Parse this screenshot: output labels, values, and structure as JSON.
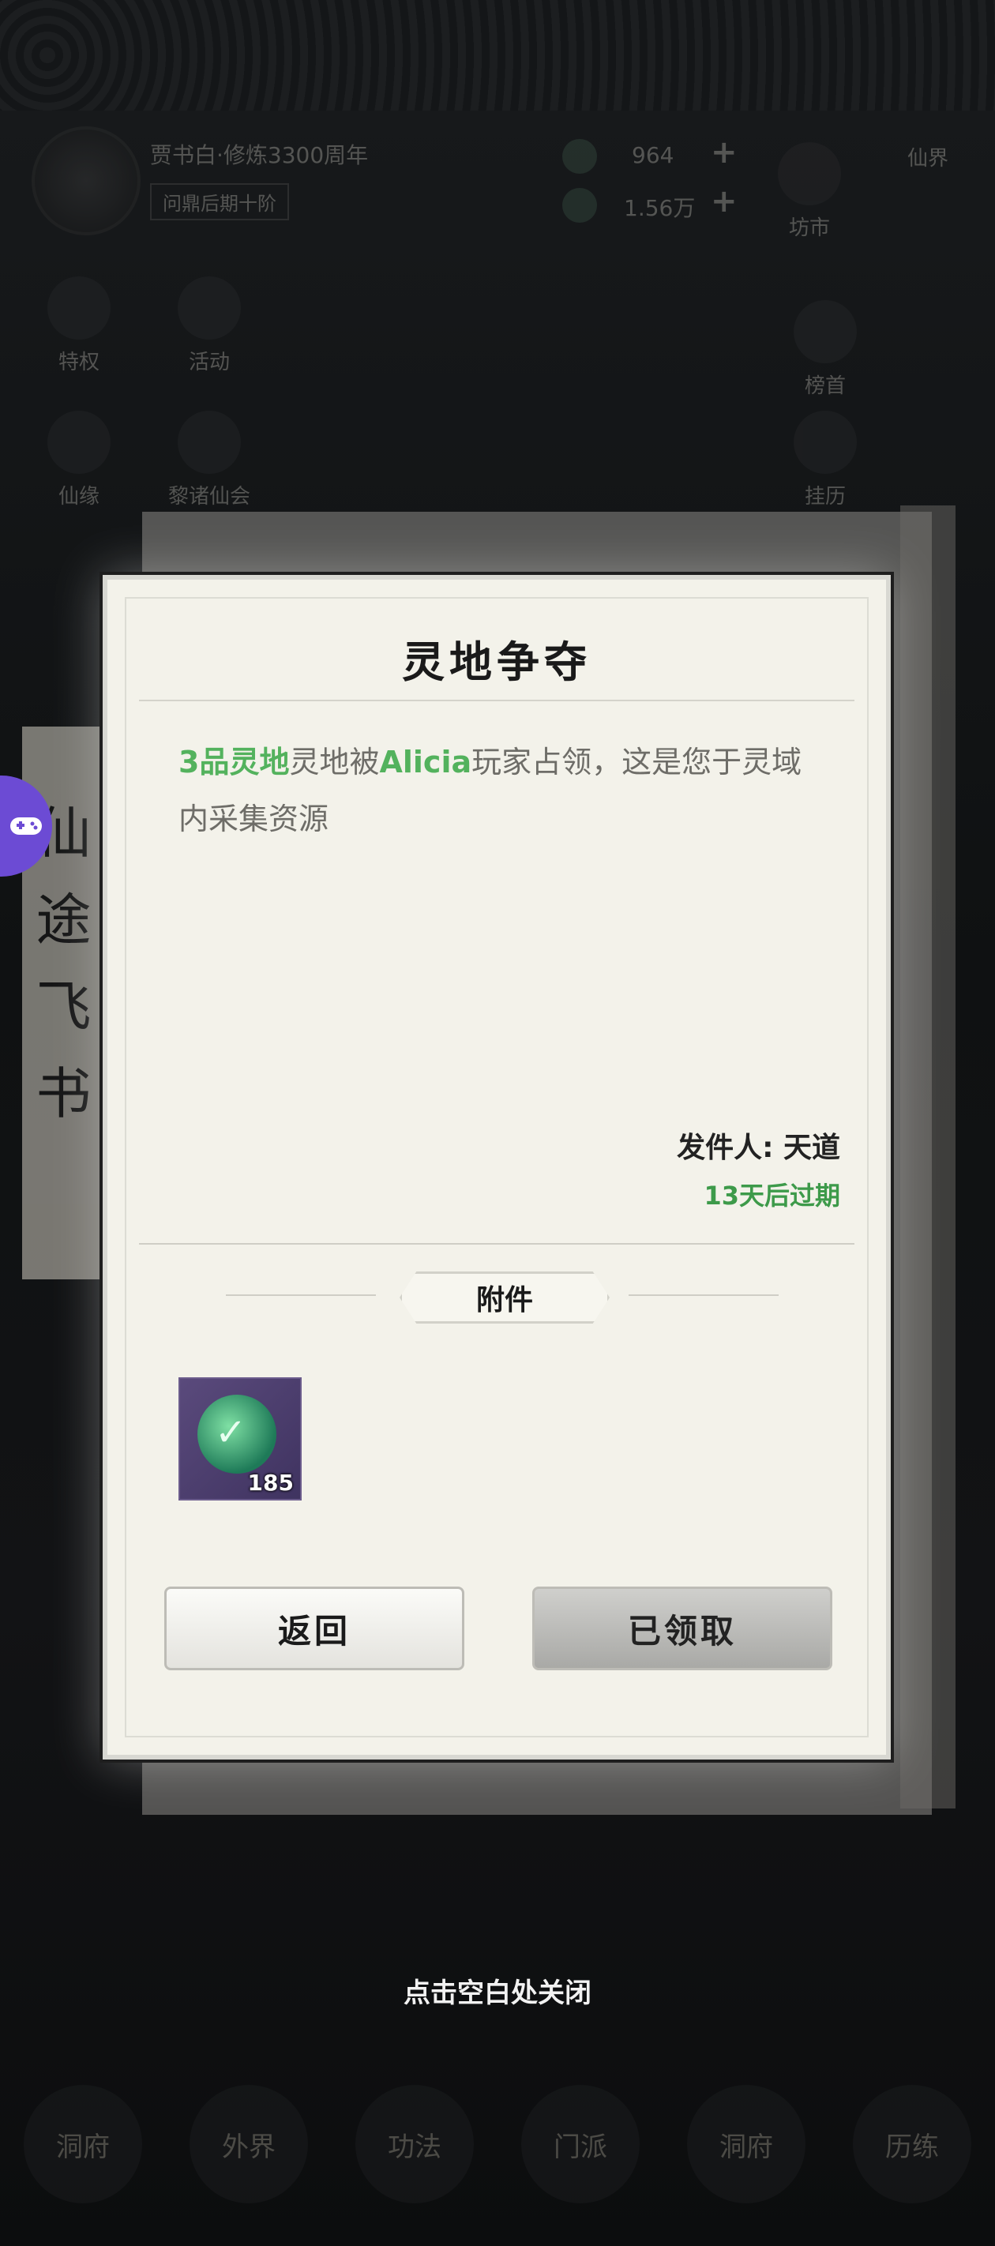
{
  "hud": {
    "player_name": "贾书白·修炼3300周年",
    "realm": "问鼎后期十阶",
    "resource1": "964",
    "resource2": "1.56万",
    "shop_label": "坊市",
    "world_label": "仙界",
    "left_icons": [
      "特权",
      "活动",
      "仙缘",
      "黎诸仙会"
    ],
    "right_icons": [
      "榜首",
      "挂历"
    ]
  },
  "bottom_nav": [
    "洞府",
    "外界",
    "功法",
    "门派",
    "洞府",
    "历练"
  ],
  "side_scroll_text": "仙途飞书",
  "dialog": {
    "title": "灵地争夺",
    "message": {
      "part1": "3品灵地",
      "part2": "灵地被",
      "part3": "Alicia",
      "part4": "玩家占领，这是您于灵域内采集资源"
    },
    "sender": "发件人: 天道",
    "expire": "13天后过期",
    "attachment_label": "附件",
    "item": {
      "icon": "jade-dragon-token-icon",
      "count": "185"
    },
    "back_button": "返回",
    "claimed_button": "已领取"
  },
  "close_hint": "点击空白处关闭",
  "colors": {
    "accent_green": "#53b25d",
    "expire_green": "#3d9a4a",
    "float_button": "#6c4bd4"
  }
}
